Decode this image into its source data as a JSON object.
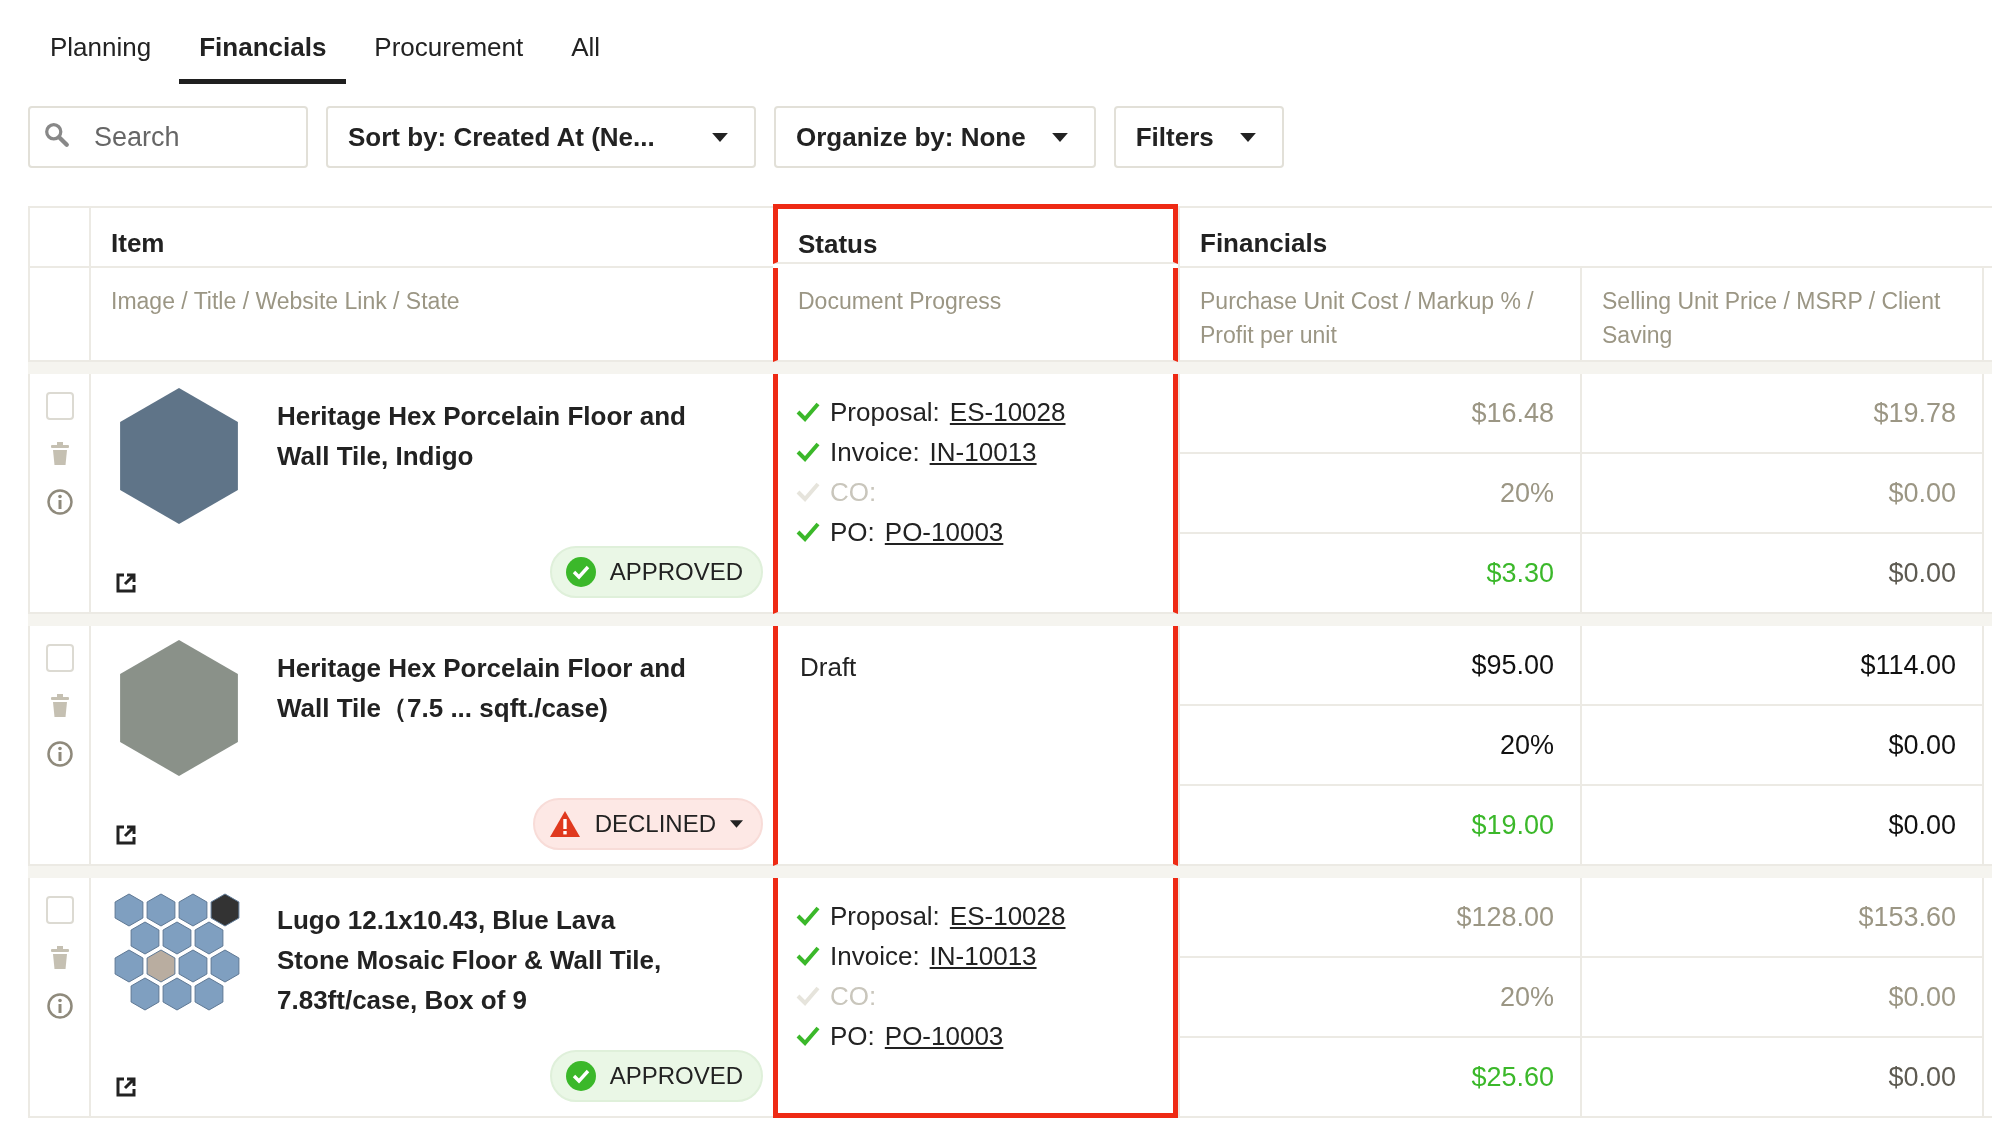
{
  "tabs": [
    {
      "label": "Planning",
      "selected": false
    },
    {
      "label": "Financials",
      "selected": true
    },
    {
      "label": "Procurement",
      "selected": false
    },
    {
      "label": "All",
      "selected": false
    }
  ],
  "toolbar": {
    "search": {
      "placeholder": "Search"
    },
    "sort": "Sort by: Created At (Ne...",
    "organize": "Organize by: None",
    "filters": "Filters"
  },
  "table": {
    "header_groups": [
      {
        "label": "Item",
        "highlighted": false
      },
      {
        "label": "Status",
        "highlighted": true
      },
      {
        "label": "Financials",
        "highlighted": false
      }
    ],
    "columns": [
      "Image / Title / Website Link / State",
      "Document Progress",
      "Purchase Unit Cost / Markup % / Profit per unit",
      "Selling Unit Price / MSRP / Client Saving"
    ],
    "rows": [
      {
        "selected": false,
        "image": {
          "kind": "hexagon",
          "color": "#5f7488"
        },
        "title": "Heritage Hex Porcelain Floor and Wall Tile, Indigo",
        "state": {
          "kind": "approved",
          "label": "APPROVED"
        },
        "status": {
          "kind": "progress",
          "docs": [
            {
              "label": "Proposal:",
              "number": "ES-10028",
              "done": true
            },
            {
              "label": "Invoice:",
              "number": "IN-10013",
              "done": true
            },
            {
              "label": "CO:",
              "done": false
            },
            {
              "label": "PO:",
              "number": "PO-10003",
              "done": true
            }
          ]
        },
        "muted": true,
        "cost": "$16.48",
        "markup": "20%",
        "profit": "$3.30",
        "price": "$19.78",
        "msrp": "$0.00",
        "saving": "$0.00"
      },
      {
        "selected": false,
        "image": {
          "kind": "hexagon",
          "color": "#8a9189"
        },
        "title": "Heritage Hex Porcelain Floor and Wall Tile（7.5 ... sqft./case)",
        "state": {
          "kind": "declined",
          "label": "DECLINED"
        },
        "status": {
          "kind": "text",
          "text": "Draft"
        },
        "muted": false,
        "cost": "$95.00",
        "markup": "20%",
        "profit": "$19.00",
        "price": "$114.00",
        "msrp": "$0.00",
        "saving": "$0.00"
      },
      {
        "selected": false,
        "image": {
          "kind": "mosaic",
          "color": "#7f9fc0"
        },
        "title": "Lugo 12.1x10.43, Blue Lava Stone Mosaic Floor & Wall Tile, 7.83ft/case, Box of 9",
        "state": {
          "kind": "approved",
          "label": "APPROVED"
        },
        "status": {
          "kind": "progress",
          "docs": [
            {
              "label": "Proposal:",
              "number": "ES-10028",
              "done": true
            },
            {
              "label": "Invoice:",
              "number": "IN-10013",
              "done": true
            },
            {
              "label": "CO:",
              "done": false
            },
            {
              "label": "PO:",
              "number": "PO-10003",
              "done": true
            }
          ]
        },
        "muted": true,
        "cost": "$128.00",
        "markup": "20%",
        "profit": "$25.60",
        "price": "$153.60",
        "msrp": "$0.00",
        "saving": "$0.00"
      }
    ]
  }
}
